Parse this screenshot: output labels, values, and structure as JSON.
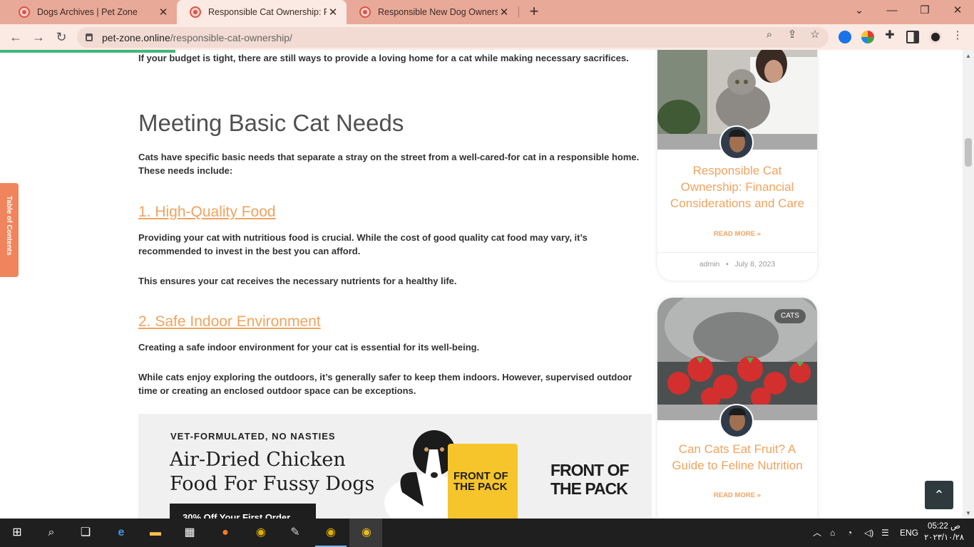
{
  "browser": {
    "tabs": [
      {
        "title": "Dogs Archives | Pet Zone",
        "active": false
      },
      {
        "title": "Responsible Cat Ownership: Fina",
        "active": true
      },
      {
        "title": "Responsible New Dog Ownershi",
        "active": false
      }
    ],
    "new_tab_label": "+",
    "url_host": "pet-zone.online",
    "url_path": "/responsible-cat-ownership/",
    "icons": [
      "back-icon",
      "forward-icon",
      "reload-icon",
      "lock-icon",
      "zoom-icon",
      "share-icon",
      "bookmark-star-icon",
      "extensions-puzzle-icon",
      "side-panel-icon",
      "profile-icon"
    ],
    "window_controls": [
      "chevron-down-icon",
      "minimize-icon",
      "maximize-icon",
      "close-icon"
    ]
  },
  "article": {
    "intro": "If your budget is tight, there are still ways to provide a loving home for a cat while making necessary sacrifices.",
    "heading": "Meeting Basic Cat Needs",
    "needs_intro": "Cats have specific basic needs that separate a stray on the street from a well-cared-for cat in a responsible home. These needs include:",
    "sections": [
      {
        "title": "1. High-Quality Food",
        "paragraphs": [
          "Providing your cat with nutritious food is crucial. While the cost of good quality cat food may vary, it’s recommended to invest in the best you can afford.",
          "This ensures your cat receives the necessary nutrients for a healthy life."
        ]
      },
      {
        "title": "2. Safe Indoor Environment",
        "paragraphs": [
          "Creating a safe indoor environment for your cat is essential for its well-being.",
          "While cats enjoy exploring the outdoors, it’s generally safer to keep them indoors. However, supervised outdoor time or creating an enclosed outdoor space can be exceptions."
        ]
      }
    ]
  },
  "ad": {
    "tagline": "VET-FORMULATED, NO NASTIES",
    "headline_line1": "Air-Dried Chicken",
    "headline_line2": "Food For Fussy Dogs",
    "cta": "30% Off Your First Order",
    "bag_label": "FRONT OF THE PACK",
    "logo_line1": "FRONT OF",
    "logo_line2": "THE PACK"
  },
  "toc": {
    "label": "Table of Contents"
  },
  "sidebar": {
    "cards": [
      {
        "title": "Responsible Cat Ownership: Financial Considerations and Care",
        "read_more": "READ MORE »",
        "author": "admin",
        "separator": "•",
        "date": "July 8, 2023"
      },
      {
        "badge": "CATS",
        "title": "Can Cats Eat Fruit? A Guide to Feline Nutrition",
        "read_more": "READ MORE »"
      }
    ]
  },
  "back_to_top": "⌃",
  "taskbar": {
    "language": "ENG",
    "time": "05:22 ص",
    "date": "٢٠٢٣/١٠/٢٨",
    "icons": [
      "start-icon",
      "search-icon",
      "task-view-icon",
      "edge-icon",
      "file-explorer-icon",
      "store-icon",
      "firefox-icon",
      "chrome-icon",
      "paint-icon",
      "chrome-profile-icon",
      "chrome-active-icon"
    ]
  },
  "colors": {
    "accent": "#f0a35e",
    "tab_bar": "#e8a998",
    "toc": "#f0845c",
    "progress": "#41b67a"
  }
}
